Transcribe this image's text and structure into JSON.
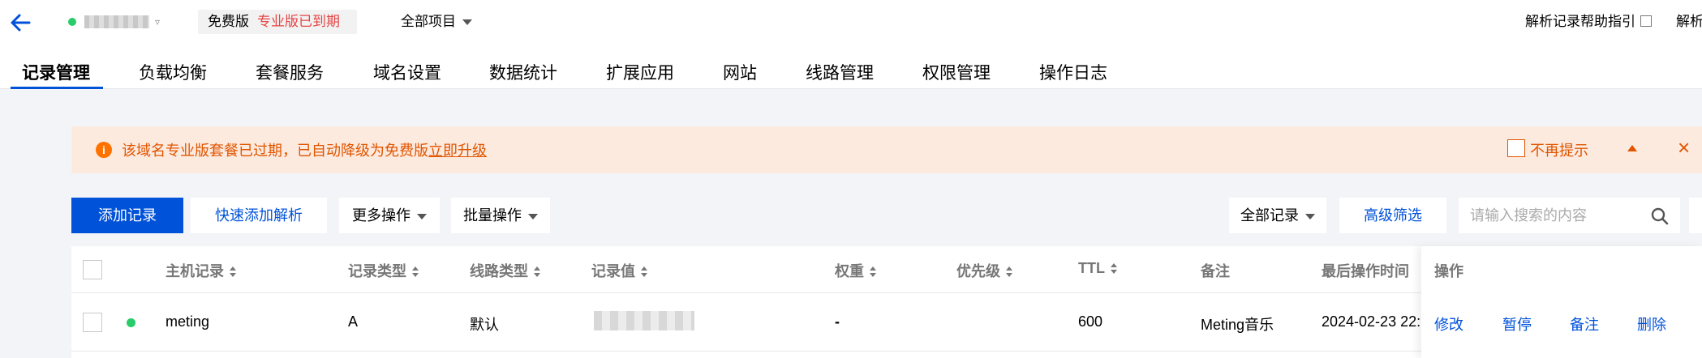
{
  "header": {
    "plan_free": "免费版",
    "plan_expired": "专业版已到期",
    "project_select": "全部项目",
    "help_link": "解析记录帮助指引",
    "help_link2": "解析"
  },
  "tabs": [
    {
      "label": "记录管理",
      "active": true
    },
    {
      "label": "负载均衡"
    },
    {
      "label": "套餐服务"
    },
    {
      "label": "域名设置"
    },
    {
      "label": "数据统计"
    },
    {
      "label": "扩展应用"
    },
    {
      "label": "网站"
    },
    {
      "label": "线路管理"
    },
    {
      "label": "权限管理"
    },
    {
      "label": "操作日志"
    }
  ],
  "alert": {
    "message": "该域名专业版套餐已过期，已自动降级为免费版",
    "link": "立即升级",
    "dismiss_label": "不再提示"
  },
  "toolbar": {
    "add_record": "添加记录",
    "quick_add": "快速添加解析",
    "more_ops": "更多操作",
    "batch_ops": "批量操作",
    "all_records": "全部记录",
    "advanced_filter": "高级筛选",
    "search_placeholder": "请输入搜索的内容"
  },
  "table": {
    "columns": {
      "host": "主机记录",
      "type": "记录类型",
      "line": "线路类型",
      "value": "记录值",
      "weight": "权重",
      "priority": "优先级",
      "ttl": "TTL",
      "remark": "备注",
      "last_op": "最后操作时间",
      "actions": "操作"
    },
    "rows": [
      {
        "host": "meting",
        "type": "A",
        "line": "默认",
        "weight": "-",
        "ttl": "600",
        "remark": "Meting音乐",
        "last_op": "2024-02-23 22:",
        "status_color": "#29cc6a"
      }
    ],
    "actions": [
      "修改",
      "暂停",
      "备注",
      "删除"
    ]
  },
  "colors": {
    "primary": "#0052d9",
    "warning": "#e05500",
    "alert_bg": "#fdeadf",
    "expired": "#e54545",
    "enabled": "#29cc6a"
  }
}
